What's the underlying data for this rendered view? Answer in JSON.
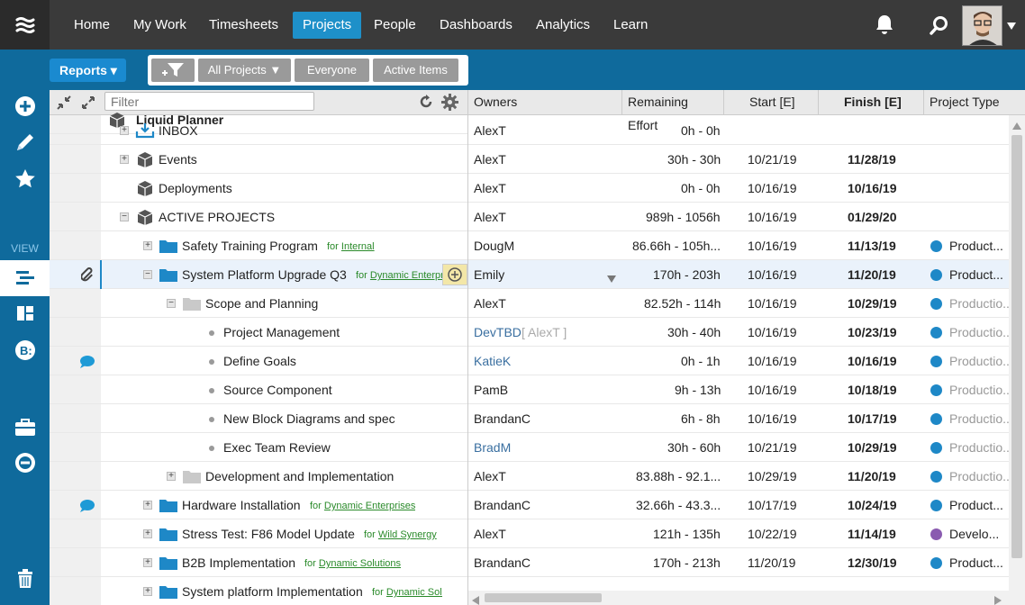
{
  "nav": {
    "items": [
      "Home",
      "My Work",
      "Timesheets",
      "Projects",
      "People",
      "Dashboards",
      "Analytics",
      "Learn"
    ],
    "active": "Projects"
  },
  "toolbar": {
    "reports_label": "Reports ▾",
    "filter_all_projects": "All Projects ▼",
    "filter_everyone": "Everyone",
    "filter_active_items": "Active Items"
  },
  "sidebar": {
    "view_label": "VIEW"
  },
  "tree": {
    "filter_placeholder": "Filter",
    "top_partial_label": "Liquid Planner"
  },
  "grid": {
    "headers": {
      "owners": "Owners",
      "remaining": "Remaining Effort",
      "start": "Start [E]",
      "finish": "Finish [E]",
      "type": "Project Type"
    }
  },
  "colors": {
    "nav_active": "#1e90c9",
    "toolbar_blue": "#0f6a9c",
    "product_blue": "#1e88c7",
    "develop_purple": "#8a5bb0"
  },
  "rows": [
    {
      "name": "INBOX",
      "for": "",
      "owner": "AlexT",
      "remaining": "0h - 0h",
      "start": "",
      "finish": "",
      "type": "",
      "type_color": ""
    },
    {
      "name": "Events",
      "for": "",
      "owner": "AlexT",
      "remaining": "30h - 30h",
      "start": "10/21/19",
      "finish": "11/28/19",
      "type": "",
      "type_color": ""
    },
    {
      "name": "Deployments",
      "for": "",
      "owner": "AlexT",
      "remaining": "0h - 0h",
      "start": "10/16/19",
      "finish": "10/16/19",
      "type": "",
      "type_color": ""
    },
    {
      "name": "ACTIVE PROJECTS",
      "for": "",
      "owner": "AlexT",
      "remaining": "989h - 1056h",
      "start": "10/16/19",
      "finish": "01/29/20",
      "type": "",
      "type_color": ""
    },
    {
      "name": "Safety Training Program",
      "for": "Internal",
      "owner": "DougM",
      "remaining": "86.66h - 105h...",
      "start": "10/16/19",
      "finish": "11/13/19",
      "type": "Product...",
      "type_color": "#1e88c7"
    },
    {
      "name": "System Platform Upgrade Q3",
      "for": "Dynamic Enterpr",
      "owner": "Emily",
      "remaining": "170h - 203h",
      "start": "10/16/19",
      "finish": "11/20/19",
      "type": "Product...",
      "type_color": "#1e88c7"
    },
    {
      "name": "Scope and Planning",
      "for": "",
      "owner": "AlexT",
      "remaining": "82.52h - 114h",
      "start": "10/16/19",
      "finish": "10/29/19",
      "type": "Productio...",
      "type_color": "#1e88c7"
    },
    {
      "name": "Project Management",
      "for": "",
      "owner": "DevTBD",
      "owner_extra": "[ AlexT ]",
      "remaining": "30h - 40h",
      "start": "10/16/19",
      "finish": "10/23/19",
      "type": "Productio...",
      "type_color": "#1e88c7"
    },
    {
      "name": "Define Goals",
      "for": "",
      "owner": "KatieK",
      "remaining": "0h - 1h",
      "start": "10/16/19",
      "finish": "10/16/19",
      "type": "Productio...",
      "type_color": "#1e88c7"
    },
    {
      "name": "Source Component",
      "for": "",
      "owner": "PamB",
      "remaining": "9h - 13h",
      "start": "10/16/19",
      "finish": "10/18/19",
      "type": "Productio...",
      "type_color": "#1e88c7"
    },
    {
      "name": "New Block Diagrams and spec",
      "for": "",
      "owner": "BrandanC",
      "remaining": "6h - 8h",
      "start": "10/16/19",
      "finish": "10/17/19",
      "type": "Productio...",
      "type_color": "#1e88c7"
    },
    {
      "name": "Exec Team Review",
      "for": "",
      "owner": "BradM",
      "remaining": "30h - 60h",
      "start": "10/21/19",
      "finish": "10/29/19",
      "type": "Productio...",
      "type_color": "#1e88c7"
    },
    {
      "name": "Development and Implementation",
      "for": "",
      "owner": "AlexT",
      "remaining": "83.88h - 92.1...",
      "start": "10/29/19",
      "finish": "11/20/19",
      "type": "Productio...",
      "type_color": "#1e88c7"
    },
    {
      "name": "Hardware Installation",
      "for": "Dynamic Enterprises",
      "owner": "BrandanC",
      "remaining": "32.66h - 43.3...",
      "start": "10/17/19",
      "finish": "10/24/19",
      "type": "Product...",
      "type_color": "#1e88c7"
    },
    {
      "name": "Stress Test: F86 Model Update",
      "for": "Wild Synergy",
      "owner": "AlexT",
      "remaining": "121h - 135h",
      "start": "10/22/19",
      "finish": "11/14/19",
      "type": "Develo...",
      "type_color": "#8a5bb0"
    },
    {
      "name": "B2B Implementation",
      "for": "Dynamic Solutions",
      "owner": "BrandanC",
      "remaining": "170h - 213h",
      "start": "11/20/19",
      "finish": "12/30/19",
      "type": "Product...",
      "type_color": "#1e88c7"
    },
    {
      "name": "System platform Implementation",
      "for": "Dynamic Soluti",
      "owner": "",
      "remaining": "",
      "start": "",
      "finish": "",
      "type": "",
      "type_color": ""
    }
  ],
  "for_prefix": "for"
}
